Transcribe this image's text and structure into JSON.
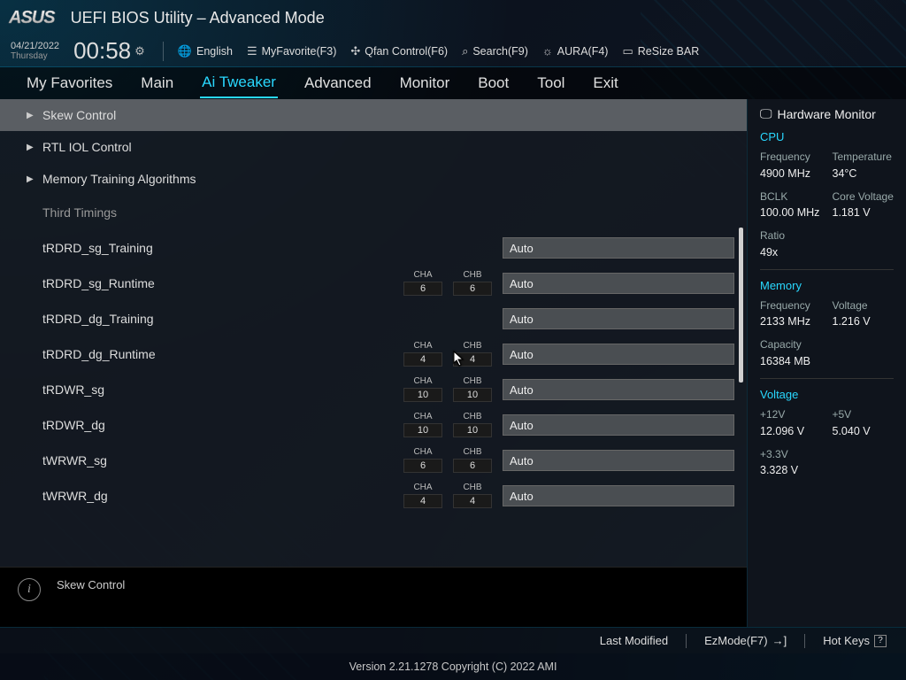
{
  "header": {
    "vendor": "ASUS",
    "title": "UEFI BIOS Utility – Advanced Mode"
  },
  "datetime": {
    "date": "04/21/2022",
    "day": "Thursday",
    "time": "00:58"
  },
  "toolbar": {
    "language": "English",
    "myfavorite": "MyFavorite(F3)",
    "qfan": "Qfan Control(F6)",
    "search": "Search(F9)",
    "aura": "AURA(F4)",
    "resizebar": "ReSize BAR"
  },
  "tabs": [
    "My Favorites",
    "Main",
    "Ai Tweaker",
    "Advanced",
    "Monitor",
    "Boot",
    "Tool",
    "Exit"
  ],
  "activeTab": "Ai Tweaker",
  "expandables": {
    "skew": "Skew Control",
    "rtl": "RTL IOL Control",
    "mta": "Memory Training Algorithms"
  },
  "subheader": "Third Timings",
  "settings": [
    {
      "name": "tRDRD_sg_Training",
      "cha": null,
      "chb": null,
      "value": "Auto"
    },
    {
      "name": "tRDRD_sg_Runtime",
      "cha": "6",
      "chb": "6",
      "value": "Auto"
    },
    {
      "name": "tRDRD_dg_Training",
      "cha": null,
      "chb": null,
      "value": "Auto"
    },
    {
      "name": "tRDRD_dg_Runtime",
      "cha": "4",
      "chb": "4",
      "value": "Auto"
    },
    {
      "name": "tRDWR_sg",
      "cha": "10",
      "chb": "10",
      "value": "Auto"
    },
    {
      "name": "tRDWR_dg",
      "cha": "10",
      "chb": "10",
      "value": "Auto"
    },
    {
      "name": "tWRWR_sg",
      "cha": "6",
      "chb": "6",
      "value": "Auto"
    },
    {
      "name": "tWRWR_dg",
      "cha": "4",
      "chb": "4",
      "value": "Auto"
    }
  ],
  "chachb_labels": {
    "cha": "CHA",
    "chb": "CHB"
  },
  "info": {
    "text": "Skew Control"
  },
  "hwmon": {
    "title": "Hardware Monitor",
    "cpu": {
      "label": "CPU",
      "freq_k": "Frequency",
      "freq_v": "4900 MHz",
      "temp_k": "Temperature",
      "temp_v": "34°C",
      "bclk_k": "BCLK",
      "bclk_v": "100.00 MHz",
      "cvolt_k": "Core Voltage",
      "cvolt_v": "1.181 V",
      "ratio_k": "Ratio",
      "ratio_v": "49x"
    },
    "mem": {
      "label": "Memory",
      "freq_k": "Frequency",
      "freq_v": "2133 MHz",
      "volt_k": "Voltage",
      "volt_v": "1.216 V",
      "cap_k": "Capacity",
      "cap_v": "16384 MB"
    },
    "volt": {
      "label": "Voltage",
      "v12_k": "+12V",
      "v12_v": "12.096 V",
      "v5_k": "+5V",
      "v5_v": "5.040 V",
      "v33_k": "+3.3V",
      "v33_v": "3.328 V"
    }
  },
  "actions": {
    "lastmod": "Last Modified",
    "ezmode": "EzMode(F7)",
    "hotkeys": "Hot Keys"
  },
  "version": "Version 2.21.1278 Copyright (C) 2022 AMI"
}
